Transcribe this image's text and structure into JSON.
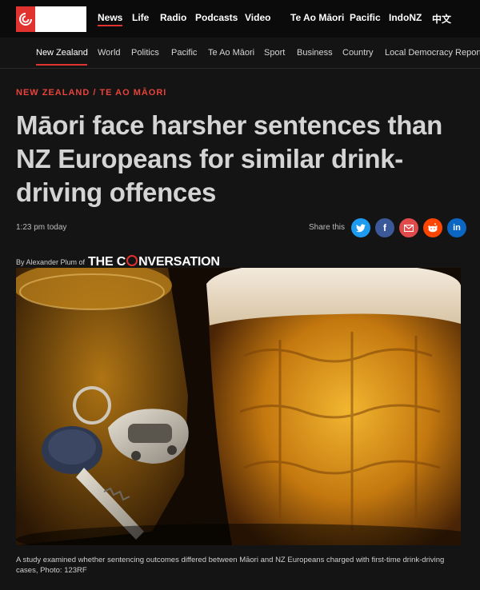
{
  "header": {
    "main_nav": [
      "News",
      "Life",
      "Radio",
      "Podcasts",
      "Video",
      "Te Ao Māori",
      "Pacific",
      "IndoNZ",
      "中文"
    ],
    "sub_nav": [
      "New Zealand",
      "World",
      "Politics",
      "Pacific",
      "Te Ao Māori",
      "Sport",
      "Business",
      "Country",
      "Local Democracy Reporting"
    ]
  },
  "article": {
    "section": "NEW ZEALAND / TE AO MĀORI",
    "headline": "Māori face harsher sentences than NZ Europeans for similar drink-driving offences",
    "timestamp": "1:23 pm today",
    "share_label": "Share this",
    "share_icons": [
      "twitter-icon",
      "facebook-icon",
      "email-icon",
      "reddit-icon",
      "linkedin-icon"
    ],
    "byline_prefix": "By Alexander Plum of",
    "publisher_part1": "THE C",
    "publisher_part2": "NVERSATION",
    "caption": "A study examined whether sentencing outcomes differed between Māori and NZ Europeans charged with first-time drink-driving cases, Photo: 123RF"
  },
  "colors": {
    "accent": "#e0322e",
    "twitter": "#1d9bf0",
    "facebook": "#3b5998",
    "email": "#e04a4a",
    "reddit": "#ff4500",
    "linkedin": "#0a66c2"
  }
}
